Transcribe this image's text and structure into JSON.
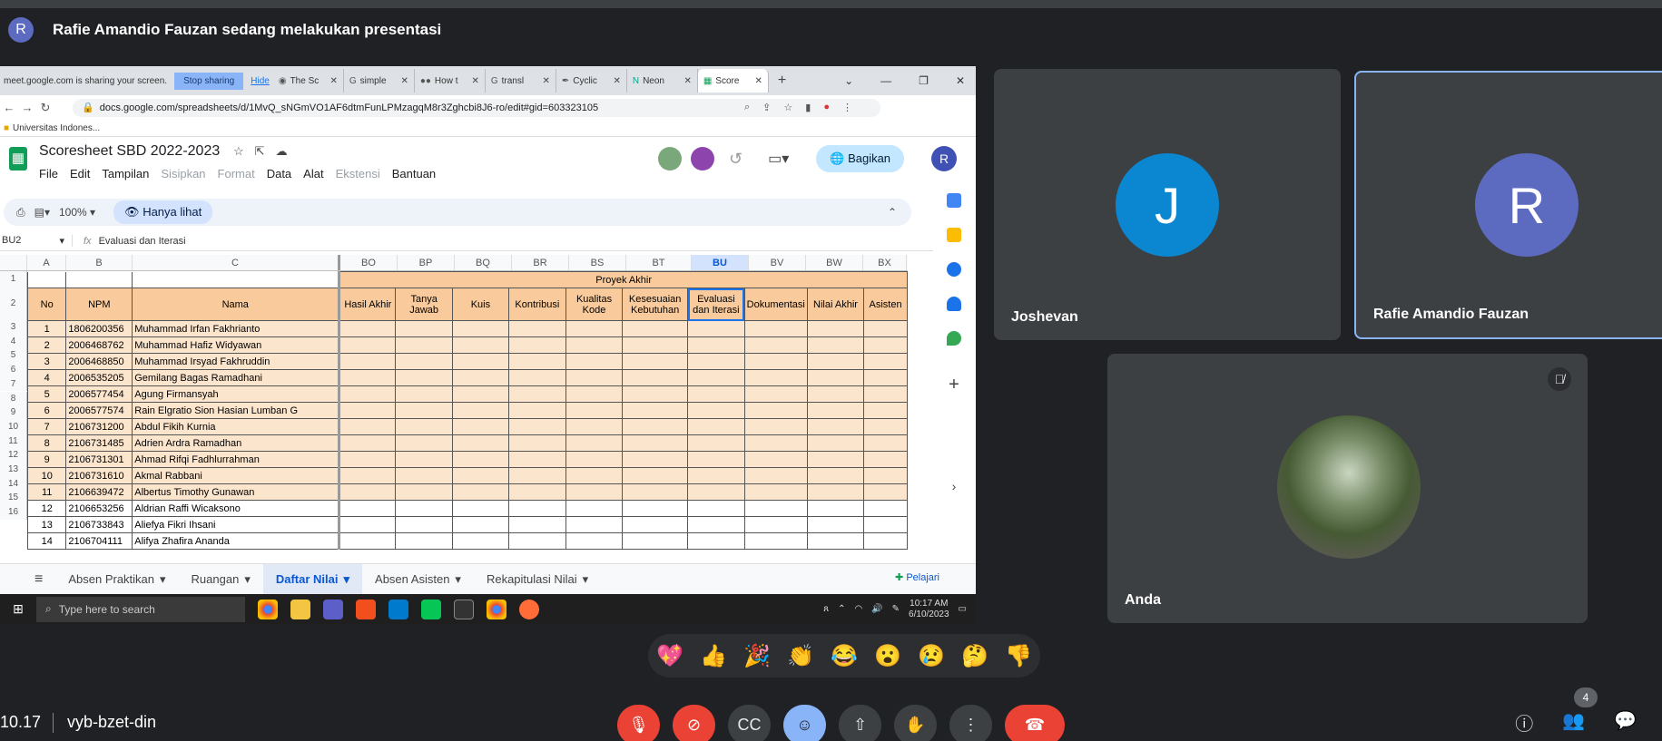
{
  "presenter": {
    "initial": "R",
    "text": "Rafie Amandio Fauzan sedang melakukan presentasi"
  },
  "browser": {
    "sharing_text": "meet.google.com is sharing your screen.",
    "stop_label": "Stop sharing",
    "hide_label": "Hide",
    "tabs": [
      {
        "label": "The Sc",
        "icon": "github"
      },
      {
        "label": "simple",
        "icon": "google"
      },
      {
        "label": "How t",
        "icon": "medium"
      },
      {
        "label": "transl",
        "icon": "google"
      },
      {
        "label": "Cyclic",
        "icon": "pen"
      },
      {
        "label": "Neon",
        "icon": "notion"
      },
      {
        "label": "Score",
        "icon": "sheets"
      }
    ],
    "url": "docs.google.com/spreadsheets/d/1MvQ_sNGmVO1AF6dtmFunLPMzagqM8r3Zghcbi8J6-ro/edit#gid=603323105",
    "bookmark": "Universitas Indones..."
  },
  "sheet": {
    "title": "Scoresheet SBD 2022-2023",
    "menu": [
      "File",
      "Edit",
      "Tampilan",
      "Sisipkan",
      "Format",
      "Data",
      "Alat",
      "Ekstensi",
      "Bantuan"
    ],
    "share_label": "Bagikan",
    "avatar": "R",
    "zoom": "100%",
    "view_mode": "Hanya lihat",
    "namebox": "BU2",
    "formula": "Evaluasi dan Iterasi",
    "col_letters": [
      "A",
      "B",
      "C",
      "BO",
      "BP",
      "BQ",
      "BR",
      "BS",
      "BT",
      "BU",
      "BV",
      "BW",
      "BX"
    ],
    "group_header": "Proyek Akhir",
    "headers": [
      "No",
      "NPM",
      "Nama",
      "Hasil Akhir",
      "Tanya Jawab",
      "Kuis",
      "Kontribusi",
      "Kualitas Kode",
      "Kesesuaian Kebutuhan",
      "Evaluasi dan Iterasi",
      "Dokumentasi",
      "Nilai Akhir",
      "Asisten"
    ],
    "row_numbers": [
      "1",
      "2",
      "3",
      "4",
      "5",
      "6",
      "7",
      "8",
      "9",
      "10",
      "11",
      "12",
      "13",
      "14",
      "15",
      "16"
    ],
    "rows": [
      [
        "1",
        "1806200356",
        "Muhammad Irfan Fakhrianto"
      ],
      [
        "2",
        "2006468762",
        "Muhammad Hafiz Widyawan"
      ],
      [
        "3",
        "2006468850",
        "Muhammad Irsyad Fakhruddin"
      ],
      [
        "4",
        "2006535205",
        "Gemilang Bagas Ramadhani"
      ],
      [
        "5",
        "2006577454",
        "Agung Firmansyah"
      ],
      [
        "6",
        "2006577574",
        "Rain Elgratio Sion Hasian Lumban G"
      ],
      [
        "7",
        "2106731200",
        "Abdul Fikih Kurnia"
      ],
      [
        "8",
        "2106731485",
        "Adrien Ardra Ramadhan"
      ],
      [
        "9",
        "2106731301",
        "Ahmad Rifqi Fadhlurrahman"
      ],
      [
        "10",
        "2106731610",
        "Akmal Rabbani"
      ],
      [
        "11",
        "2106639472",
        "Albertus Timothy Gunawan"
      ],
      [
        "12",
        "2106653256",
        "Aldrian Raffi Wicaksono"
      ],
      [
        "13",
        "2106733843",
        "Aliefya Fikri Ihsani"
      ],
      [
        "14",
        "2106704111",
        "Alifya Zhafira Ananda"
      ]
    ],
    "sheet_tabs": [
      "Absen Praktikan",
      "Ruangan",
      "Daftar Nilai",
      "Absen Asisten",
      "Rekapitulasi Nilai"
    ],
    "active_tab": "Daftar Nilai",
    "learn_label": "Pelajari"
  },
  "taskbar": {
    "search_placeholder": "Type here to search",
    "time": "10:17 AM",
    "date": "6/10/2023"
  },
  "tiles": {
    "joshevan": {
      "name": "Joshevan",
      "initial": "J",
      "color": "#0b87d1"
    },
    "rafie": {
      "name": "Rafie Amandio Fauzan",
      "initial": "R",
      "color": "#5c6bc0"
    },
    "self": {
      "name": "Anda"
    }
  },
  "reactions": [
    "💖",
    "👍",
    "🎉",
    "👏",
    "😂",
    "😮",
    "😢",
    "🤔",
    "👎"
  ],
  "bottom": {
    "time": "10.17",
    "meeting_code": "vyb-bzet-din",
    "participant_count": "4"
  }
}
